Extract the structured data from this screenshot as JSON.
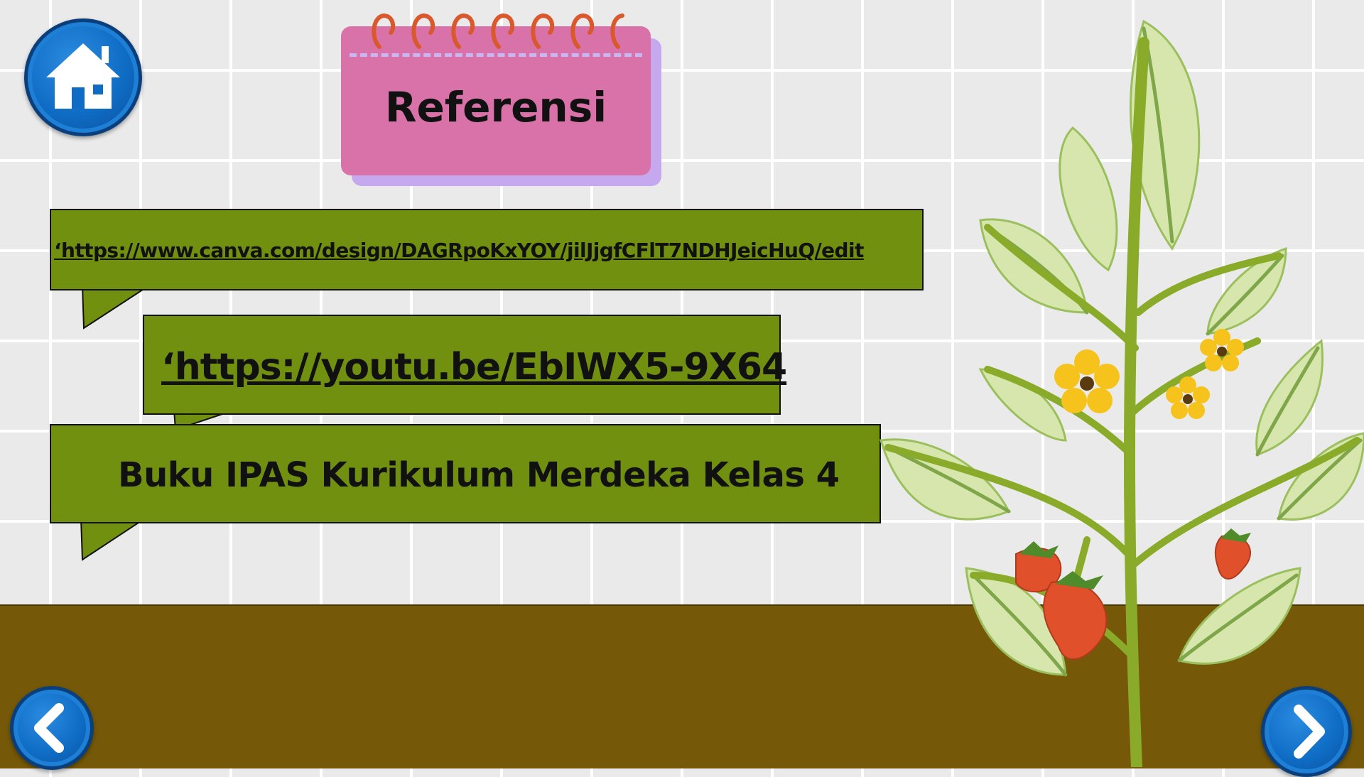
{
  "page": {
    "title": "Referensi"
  },
  "references": [
    {
      "text": "‘https://www.canva.com/design/DAGRpoKxYOY/jilJjgfCFlT7NDHJeicHuQ/edit",
      "is_link": true
    },
    {
      "text": "‘https://youtu.be/EbIWX5-9X64",
      "is_link": true
    },
    {
      "text": "Buku IPAS Kurikulum Merdeka Kelas 4",
      "is_link": false
    }
  ],
  "navigation": {
    "home_icon": "home-icon",
    "prev_icon": "chevron-left-icon",
    "next_icon": "chevron-right-icon"
  },
  "colors": {
    "bubble": "#72900f",
    "notepad": "#d872a8",
    "notepad_shadow": "#c5a8ee",
    "ground": "#755908",
    "button_blue": "#0f6cc4"
  }
}
